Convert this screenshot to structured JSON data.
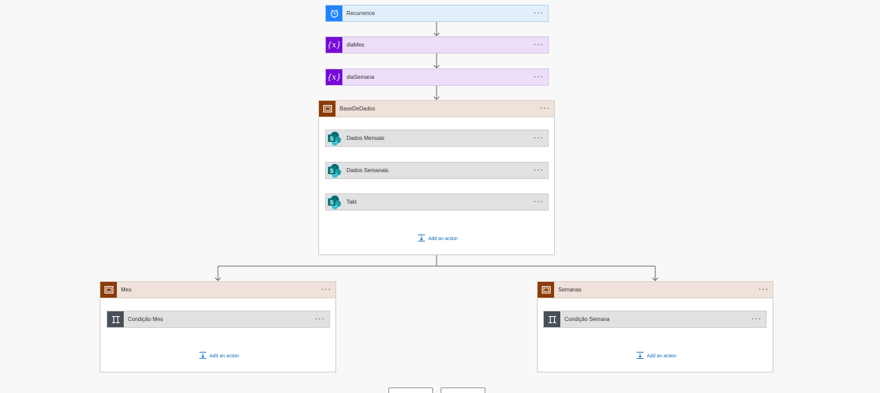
{
  "colors": {
    "canvas_bg": "#f8f8f8",
    "recurrence": "#1f85ff",
    "variable": "#770bd6",
    "scope": "#8a3c09",
    "condition": "#484f58",
    "sharepoint": "#038387",
    "link": "#0f6cbd"
  },
  "flow": {
    "recurrence": {
      "label": "Recurrence",
      "icon": "alarm-clock-icon"
    },
    "dia_mes": {
      "label": "diaMes",
      "icon": "variable-icon"
    },
    "dia_semana": {
      "label": "diaSemana",
      "icon": "variable-icon"
    },
    "base_de_dados": {
      "label": "BaseDeDados",
      "icon": "scope-icon",
      "actions": [
        {
          "label": "Dados Mensais",
          "icon": "sharepoint-icon"
        },
        {
          "label": "Dados Semanais",
          "icon": "sharepoint-icon"
        },
        {
          "label": "Takt",
          "icon": "sharepoint-icon"
        }
      ],
      "add_action": "Add an action"
    },
    "mes": {
      "label": "Mes",
      "icon": "scope-icon",
      "actions": [
        {
          "label": "Condição Mes",
          "icon": "condition-icon"
        }
      ],
      "add_action": "Add an action"
    },
    "semanas": {
      "label": "Semanas",
      "icon": "scope-icon",
      "actions": [
        {
          "label": "Condição Semana",
          "icon": "condition-icon"
        }
      ],
      "add_action": "Add an action"
    },
    "more_label": "···"
  }
}
